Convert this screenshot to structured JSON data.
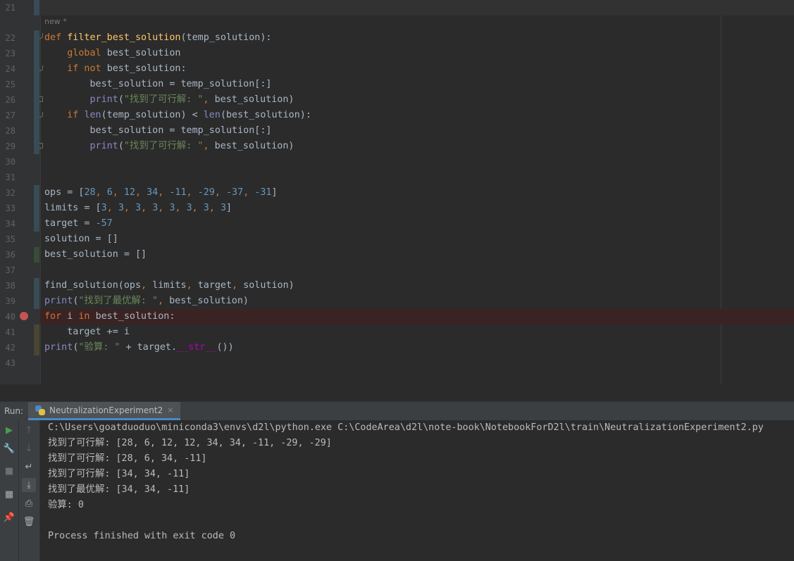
{
  "editor": {
    "inlay_hint": "new *",
    "lines": [
      {
        "n": "21",
        "tokens": []
      },
      {
        "n": "22",
        "tokens": [
          [
            "kw",
            "def "
          ],
          [
            "fn",
            "filter_best_solution"
          ],
          [
            "pl",
            "(temp_solution):"
          ]
        ]
      },
      {
        "n": "23",
        "tokens": [
          [
            "pl",
            "    "
          ],
          [
            "kw",
            "global "
          ],
          [
            "pl",
            "best_solution"
          ]
        ]
      },
      {
        "n": "24",
        "tokens": [
          [
            "pl",
            "    "
          ],
          [
            "kw",
            "if not "
          ],
          [
            "pl",
            "best_solution:"
          ]
        ]
      },
      {
        "n": "25",
        "tokens": [
          [
            "pl",
            "        best_solution = temp_solution[:]"
          ]
        ]
      },
      {
        "n": "26",
        "tokens": [
          [
            "pl",
            "        "
          ],
          [
            "bi",
            "print"
          ],
          [
            "pl",
            "("
          ],
          [
            "str",
            "\"找到了可行解: \""
          ],
          [
            "kw",
            ", "
          ],
          [
            "pl",
            "best_solution)"
          ]
        ]
      },
      {
        "n": "27",
        "tokens": [
          [
            "pl",
            "    "
          ],
          [
            "kw",
            "if "
          ],
          [
            "bi",
            "len"
          ],
          [
            "pl",
            "(temp_solution) < "
          ],
          [
            "bi",
            "len"
          ],
          [
            "pl",
            "(best_solution):"
          ]
        ]
      },
      {
        "n": "28",
        "tokens": [
          [
            "pl",
            "        best_solution = temp_solution[:]"
          ]
        ]
      },
      {
        "n": "29",
        "tokens": [
          [
            "pl",
            "        "
          ],
          [
            "bi",
            "print"
          ],
          [
            "pl",
            "("
          ],
          [
            "str",
            "\"找到了可行解: \""
          ],
          [
            "kw",
            ", "
          ],
          [
            "pl",
            "best_solution)"
          ]
        ]
      },
      {
        "n": "30",
        "tokens": []
      },
      {
        "n": "31",
        "tokens": []
      },
      {
        "n": "32",
        "tokens": [
          [
            "pl",
            "ops = ["
          ],
          [
            "num",
            "28"
          ],
          [
            "kw",
            ", "
          ],
          [
            "num",
            "6"
          ],
          [
            "kw",
            ", "
          ],
          [
            "num",
            "12"
          ],
          [
            "kw",
            ", "
          ],
          [
            "num",
            "34"
          ],
          [
            "kw",
            ", "
          ],
          [
            "num",
            "-11"
          ],
          [
            "kw",
            ", "
          ],
          [
            "num",
            "-29"
          ],
          [
            "kw",
            ", "
          ],
          [
            "num",
            "-37"
          ],
          [
            "kw",
            ", "
          ],
          [
            "num",
            "-31"
          ],
          [
            "pl",
            "]"
          ]
        ]
      },
      {
        "n": "33",
        "tokens": [
          [
            "pl",
            "limits = ["
          ],
          [
            "num",
            "3"
          ],
          [
            "kw",
            ", "
          ],
          [
            "num",
            "3"
          ],
          [
            "kw",
            ", "
          ],
          [
            "num",
            "3"
          ],
          [
            "kw",
            ", "
          ],
          [
            "num",
            "3"
          ],
          [
            "kw",
            ", "
          ],
          [
            "num",
            "3"
          ],
          [
            "kw",
            ", "
          ],
          [
            "num",
            "3"
          ],
          [
            "kw",
            ", "
          ],
          [
            "num",
            "3"
          ],
          [
            "kw",
            ", "
          ],
          [
            "num",
            "3"
          ],
          [
            "pl",
            "]"
          ]
        ]
      },
      {
        "n": "34",
        "tokens": [
          [
            "pl",
            "target = "
          ],
          [
            "num",
            "-57"
          ]
        ]
      },
      {
        "n": "35",
        "tokens": [
          [
            "pl",
            "solution = []"
          ]
        ]
      },
      {
        "n": "36",
        "tokens": [
          [
            "pl",
            "best_solution = []"
          ]
        ]
      },
      {
        "n": "37",
        "tokens": []
      },
      {
        "n": "38",
        "tokens": [
          [
            "pl",
            "find_solution(ops"
          ],
          [
            "kw",
            ", "
          ],
          [
            "pl",
            "limits"
          ],
          [
            "kw",
            ", "
          ],
          [
            "pl",
            "target"
          ],
          [
            "kw",
            ", "
          ],
          [
            "pl",
            "solution)"
          ]
        ]
      },
      {
        "n": "39",
        "tokens": [
          [
            "bi",
            "print"
          ],
          [
            "pl",
            "("
          ],
          [
            "str",
            "\"找到了最优解: \""
          ],
          [
            "kw",
            ", "
          ],
          [
            "pl",
            "best_solution)"
          ]
        ]
      },
      {
        "n": "40",
        "tokens": [
          [
            "kw",
            "for "
          ],
          [
            "pl",
            "i "
          ],
          [
            "kw",
            "in "
          ],
          [
            "pl",
            "best_solution:"
          ]
        ]
      },
      {
        "n": "41",
        "tokens": [
          [
            "pl",
            "    target += i"
          ]
        ]
      },
      {
        "n": "42",
        "tokens": [
          [
            "bi",
            "print"
          ],
          [
            "pl",
            "("
          ],
          [
            "str",
            "\"验算: \""
          ],
          [
            "pl",
            " + target."
          ],
          [
            "dun",
            "__str__"
          ],
          [
            "pl",
            "())"
          ]
        ]
      },
      {
        "n": "43",
        "tokens": []
      }
    ]
  },
  "run": {
    "label": "Run:",
    "tab_label": "NeutralizationExperiment2",
    "tab_close": "×",
    "output": [
      "C:\\Users\\goatduoduo\\miniconda3\\envs\\d2l\\python.exe C:\\CodeArea\\d2l\\note-book\\NotebookForD2l\\train\\NeutralizationExperiment2.py",
      "找到了可行解: [28, 6, 12, 12, 34, 34, -11, -29, -29]",
      "找到了可行解: [28, 6, 34, -11]",
      "找到了可行解: [34, 34, -11]",
      "找到了最优解: [34, 34, -11]",
      "验算: 0",
      "",
      "Process finished with exit code 0"
    ],
    "toolbar_left": [
      {
        "name": "rerun-icon",
        "glyph": "▶",
        "color": "#499c54"
      },
      {
        "name": "wrench-icon",
        "glyph": "🔧",
        "color": "#aeb1b4"
      },
      {
        "name": "stop-icon",
        "glyph": "■",
        "color": "#6e6e6e"
      },
      {
        "name": "layout-icon",
        "glyph": "▦",
        "color": "#aeb1b4"
      },
      {
        "name": "pin-icon",
        "glyph": "📌",
        "color": "#aeb1b4"
      }
    ],
    "toolbar_right": [
      {
        "name": "scroll-up-icon",
        "glyph": "↑",
        "color": "#5e6060"
      },
      {
        "name": "scroll-down-icon",
        "glyph": "↓",
        "color": "#5e6060"
      },
      {
        "name": "soft-wrap-icon",
        "glyph": "↵",
        "color": "#aeb1b4"
      },
      {
        "name": "scroll-to-end-icon",
        "glyph": "⤓",
        "color": "#aeb1b4"
      },
      {
        "name": "print-icon",
        "glyph": "⎙",
        "color": "#aeb1b4"
      },
      {
        "name": "trash-icon",
        "glyph": "🗑",
        "color": "#aeb1b4"
      }
    ]
  }
}
